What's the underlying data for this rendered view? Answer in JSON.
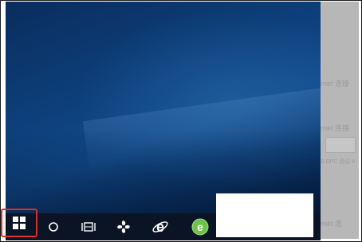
{
  "side_panel": {
    "items": [
      {
        "text": "rnet 连接"
      },
      {
        "text": "rnet 连接"
      },
      {
        "text": "S.DPC 协议 4"
      },
      {
        "text": "rnet 连"
      }
    ]
  },
  "taskbar": {
    "buttons": [
      {
        "name": "start-button",
        "icon": "windows-logo-icon"
      },
      {
        "name": "cortana-button",
        "icon": "circle-icon"
      },
      {
        "name": "task-view-button",
        "icon": "task-view-icon"
      },
      {
        "name": "pinned-fan-app-button",
        "icon": "fan-icon"
      },
      {
        "name": "internet-explorer-button",
        "icon": "internet-explorer-icon"
      },
      {
        "name": "green-e-browser-button",
        "icon": "green-e-browser-icon"
      }
    ]
  },
  "colors": {
    "highlight": "#d8302f",
    "taskbar": "#0b1424",
    "desktop": "#0d3f7a",
    "side_panel": "#b7b7b7"
  }
}
